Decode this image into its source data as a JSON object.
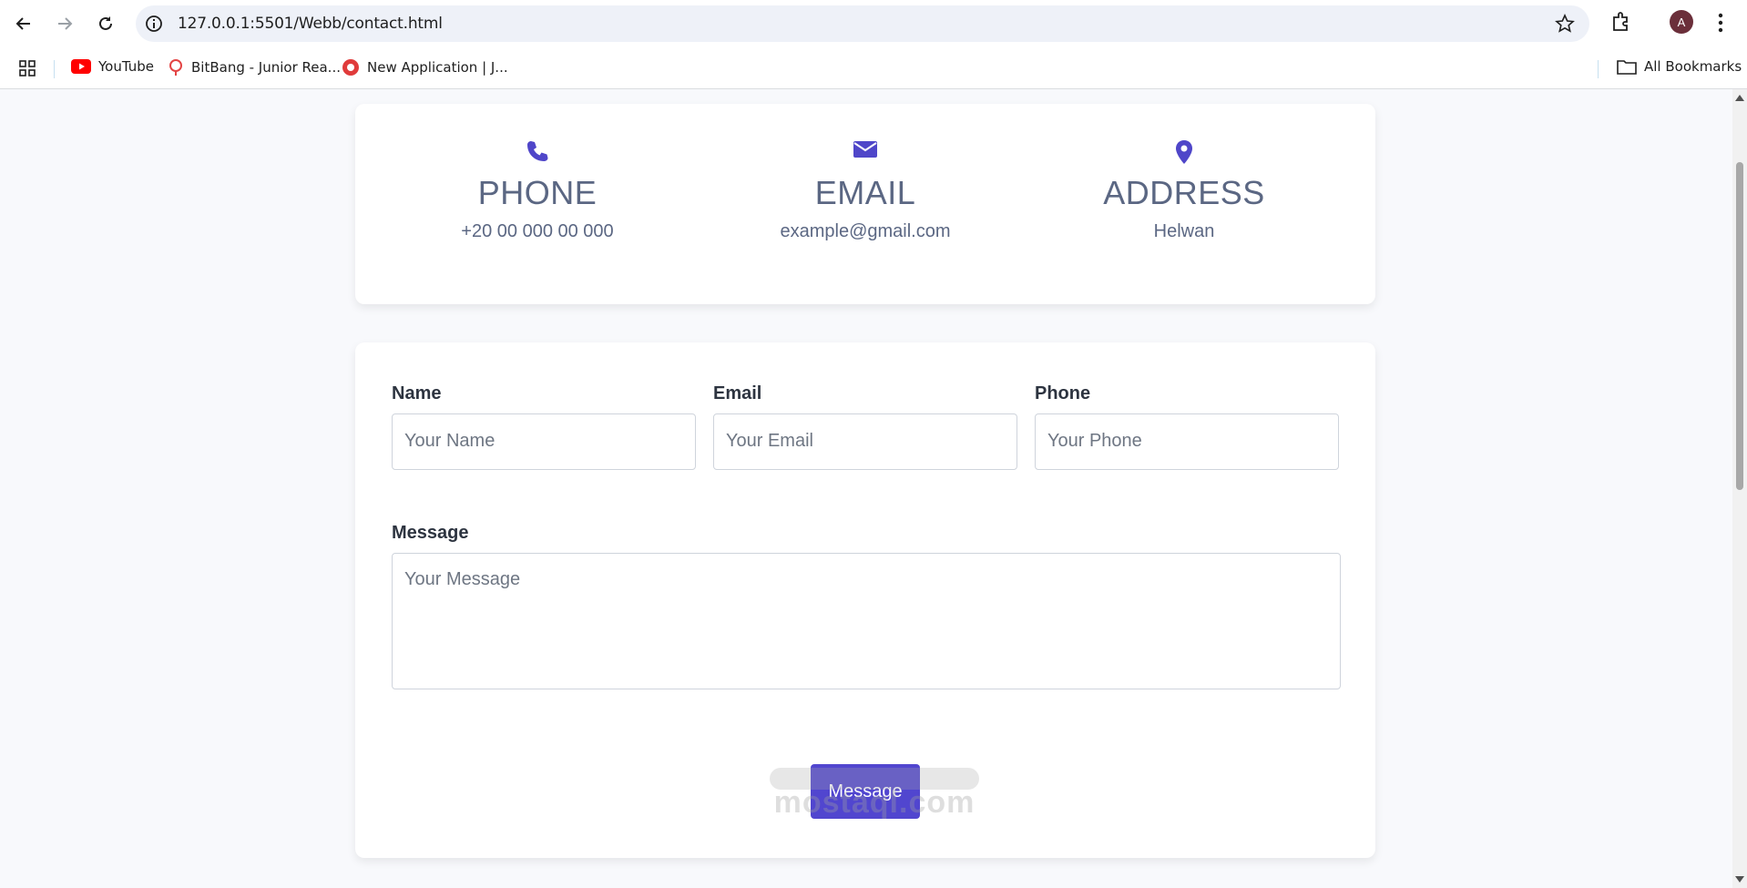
{
  "browser": {
    "url": "127.0.0.1:5501/Webb/contact.html",
    "bookmarks": [
      {
        "label": "YouTube",
        "icon": "youtube-icon"
      },
      {
        "label": "BitBang - Junior Rea...",
        "icon": "bitbang-icon"
      },
      {
        "label": "New Application | J...",
        "icon": "application-icon"
      }
    ],
    "all_bookmarks": "All Bookmarks",
    "profile_initial": "A"
  },
  "info": {
    "phone": {
      "title": "PHONE",
      "value": "+20 00 000 00 000",
      "icon": "phone-icon"
    },
    "email": {
      "title": "EMAIL",
      "value": "example@gmail.com",
      "icon": "envelope-icon"
    },
    "address": {
      "title": "ADDRESS",
      "value": "Helwan",
      "icon": "map-pin-icon"
    }
  },
  "form": {
    "name_label": "Name",
    "name_placeholder": "Your Name",
    "email_label": "Email",
    "email_placeholder": "Your Email",
    "phone_label": "Phone",
    "phone_placeholder": "Your Phone",
    "message_label": "Message",
    "message_placeholder": "Your Message",
    "submit_label": "Message"
  },
  "watermark": "mostaql.com",
  "colors": {
    "accent": "#5146cf",
    "text_muted": "#5b6783"
  }
}
